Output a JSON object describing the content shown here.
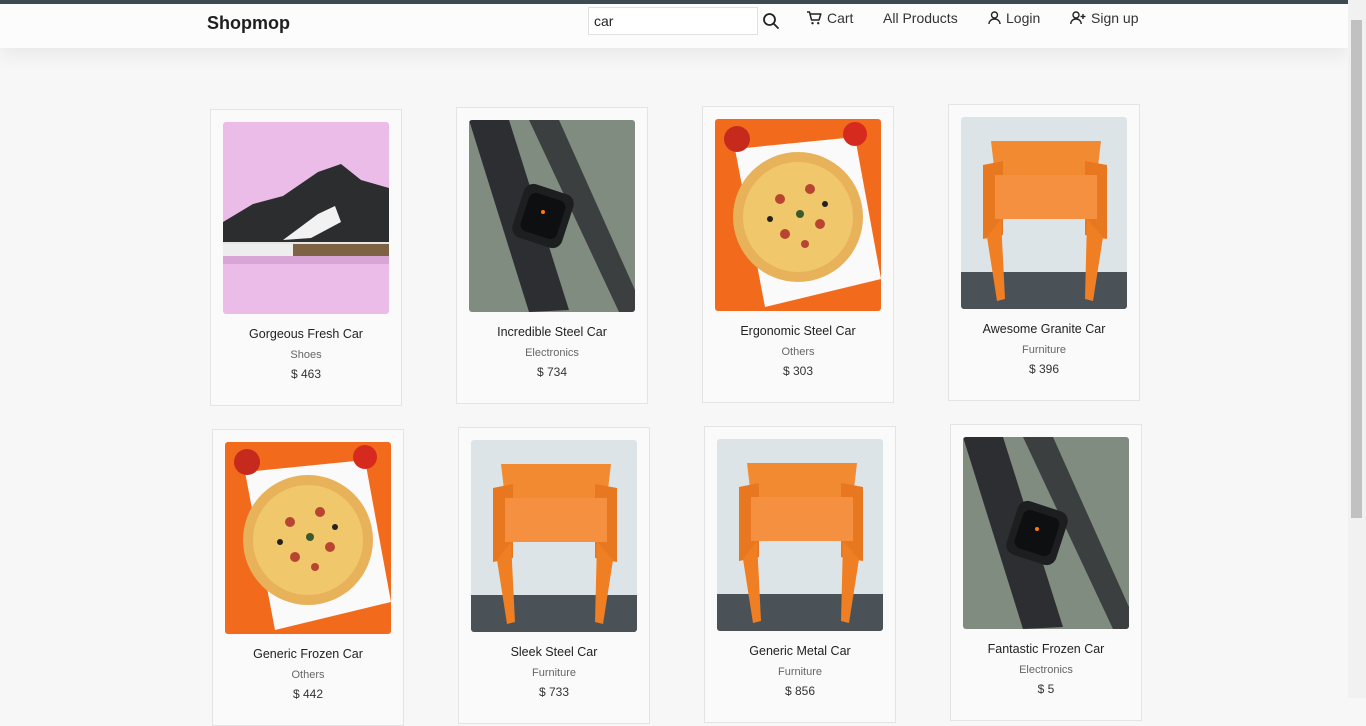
{
  "brand": "Shopmop",
  "search": {
    "value": "car"
  },
  "nav": {
    "cart": "Cart",
    "all_products": "All Products",
    "login": "Login",
    "signup": "Sign up"
  },
  "products": [
    {
      "name": "Gorgeous Fresh Car",
      "category": "Shoes",
      "price": "$ 463",
      "image": "sneaker"
    },
    {
      "name": "Incredible Steel Car",
      "category": "Electronics",
      "price": "$ 734",
      "image": "smartwatch"
    },
    {
      "name": "Ergonomic Steel Car",
      "category": "Others",
      "price": "$ 303",
      "image": "pizza"
    },
    {
      "name": "Awesome Granite Car",
      "category": "Furniture",
      "price": "$ 396",
      "image": "orange-chair"
    },
    {
      "name": "Generic Frozen Car",
      "category": "Others",
      "price": "$ 442",
      "image": "pizza"
    },
    {
      "name": "Sleek Steel Car",
      "category": "Furniture",
      "price": "$ 733",
      "image": "orange-chair"
    },
    {
      "name": "Generic Metal Car",
      "category": "Furniture",
      "price": "$ 856",
      "image": "orange-chair"
    },
    {
      "name": "Fantastic Frozen Car",
      "category": "Electronics",
      "price": "$ 5",
      "image": "smartwatch"
    }
  ]
}
